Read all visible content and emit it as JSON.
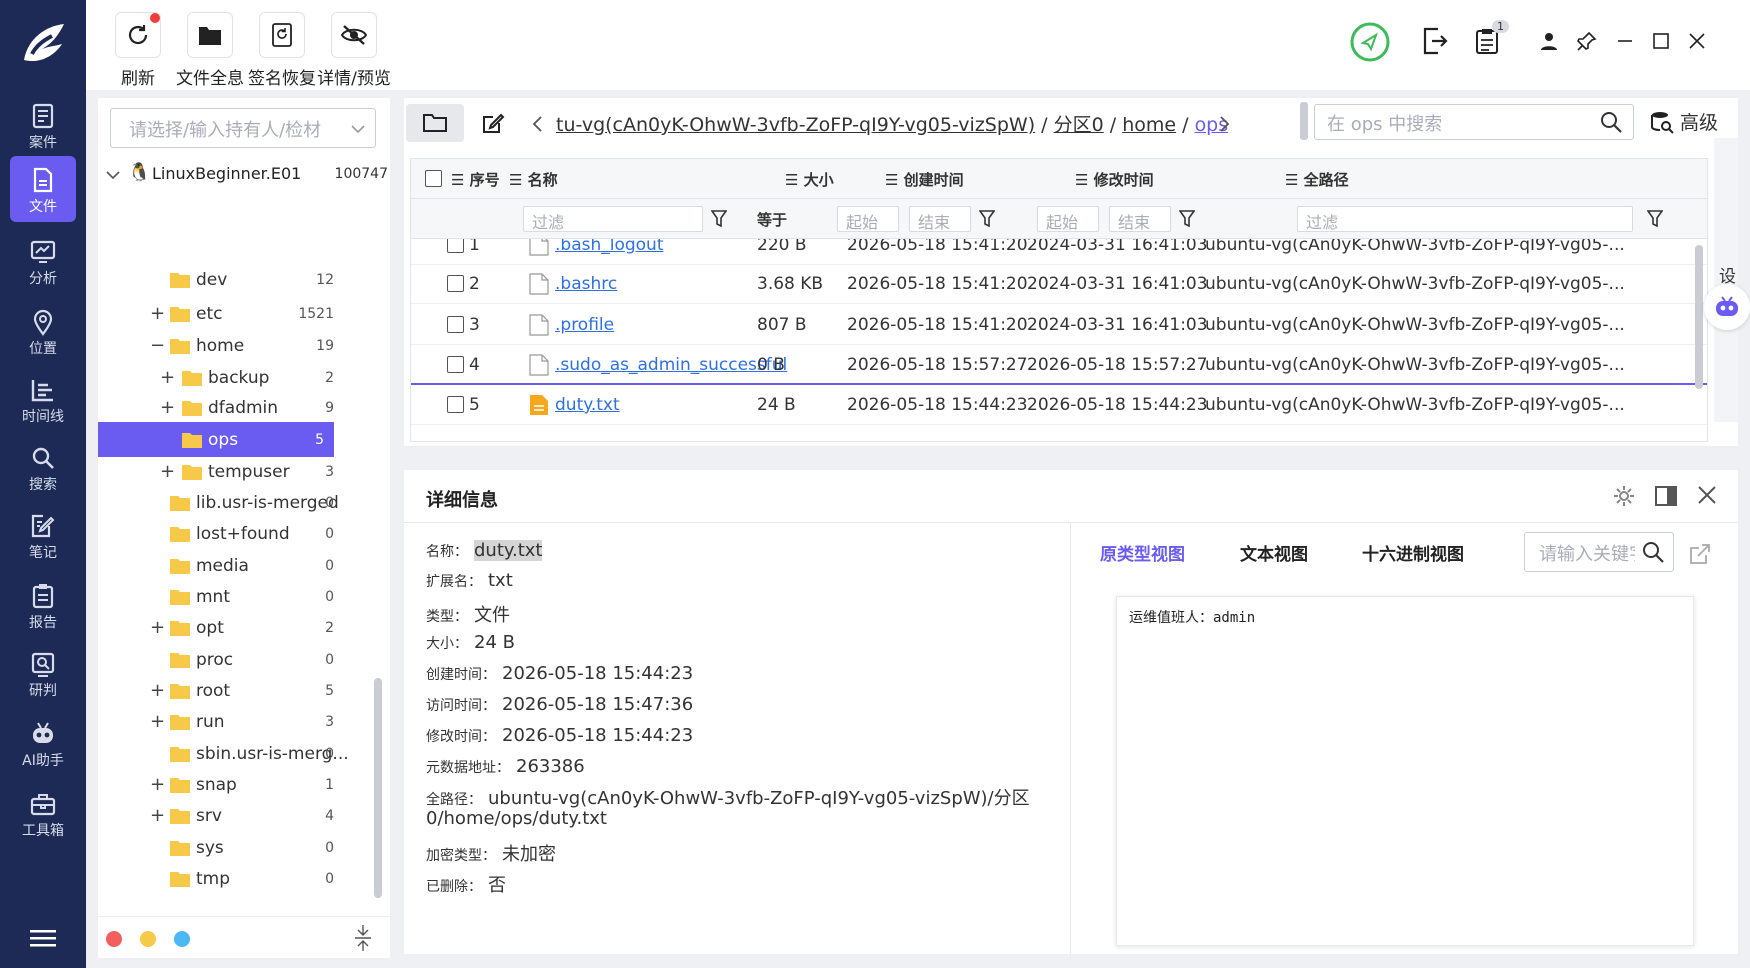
{
  "nav": {
    "items": [
      {
        "label": "案件",
        "icon": "case-icon"
      },
      {
        "label": "文件",
        "icon": "file-icon",
        "active": true
      },
      {
        "label": "分析",
        "icon": "analysis-icon"
      },
      {
        "label": "位置",
        "icon": "location-icon"
      },
      {
        "label": "时间线",
        "icon": "timeline-icon"
      },
      {
        "label": "搜索",
        "icon": "search-icon"
      },
      {
        "label": "笔记",
        "icon": "note-icon"
      },
      {
        "label": "报告",
        "icon": "report-icon"
      },
      {
        "label": "研判",
        "icon": "judge-icon"
      },
      {
        "label": "AI助手",
        "icon": "robot-icon"
      },
      {
        "label": "工具箱",
        "icon": "toolbox-icon"
      }
    ]
  },
  "toolbar": {
    "refresh": "刷新",
    "all_files": "文件全息",
    "sig_recover": "签名恢复",
    "detail_preview": "详情/预览",
    "badge_count": "1"
  },
  "tree": {
    "owner_placeholder": "请选择/输入持有人/检材",
    "root": {
      "label": "LinuxBeginner.E01",
      "count": "100747"
    },
    "rows": [
      {
        "toggle": "",
        "label": "dev",
        "count": "12"
      },
      {
        "toggle": "+",
        "label": "etc",
        "count": "1521"
      },
      {
        "toggle": "−",
        "label": "home",
        "count": "19"
      },
      {
        "toggle": "+",
        "label": "backup",
        "count": "2"
      },
      {
        "toggle": "+",
        "label": "dfadmin",
        "count": "9"
      },
      {
        "toggle": "",
        "label": "ops",
        "count": "5",
        "active": true
      },
      {
        "toggle": "+",
        "label": "tempuser",
        "count": "3"
      },
      {
        "toggle": "",
        "label": "lib.usr-is-merged",
        "count": "0"
      },
      {
        "toggle": "",
        "label": "lost+found",
        "count": "0"
      },
      {
        "toggle": "",
        "label": "media",
        "count": "0"
      },
      {
        "toggle": "",
        "label": "mnt",
        "count": "0"
      },
      {
        "toggle": "+",
        "label": "opt",
        "count": "2"
      },
      {
        "toggle": "",
        "label": "proc",
        "count": "0"
      },
      {
        "toggle": "+",
        "label": "root",
        "count": "5"
      },
      {
        "toggle": "+",
        "label": "run",
        "count": "3"
      },
      {
        "toggle": "",
        "label": "sbin.usr-is-merg...",
        "count": "0"
      },
      {
        "toggle": "+",
        "label": "snap",
        "count": "1"
      },
      {
        "toggle": "+",
        "label": "srv",
        "count": "4"
      },
      {
        "toggle": "",
        "label": "sys",
        "count": "0"
      },
      {
        "toggle": "",
        "label": "tmp",
        "count": "0"
      }
    ],
    "dots": [
      "#f25f5c",
      "#f7c948",
      "#4cb8f5"
    ]
  },
  "pathbar": {
    "crumb_partition_path": "tu-vg(cAn0yK-OhwW-3vfb-ZoFP-qI9Y-vg05-vizSpW)",
    "sep": " / ",
    "crumb_partition": "分区0",
    "crumb_home": "home",
    "crumb_ops": "ops",
    "search_placeholder": "在 ops 中搜索",
    "advanced": "高级"
  },
  "grid": {
    "headers": {
      "index": "序号",
      "name": "名称",
      "size": "大小",
      "created": "创建时间",
      "modified": "修改时间",
      "fullpath": "全路径"
    },
    "filter": {
      "placeholder": "过滤",
      "equals": "等于",
      "start": "起始",
      "end": "结束"
    },
    "rows": [
      {
        "index": "1",
        "name": ".bash_logout",
        "size": "220 B",
        "created": "2026-05-18 15:41:20",
        "modified": "2024-03-31 16:41:03",
        "path": "ubuntu-vg(cAn0yK-OhwW-3vfb-ZoFP-qI9Y-vg05-..."
      },
      {
        "index": "2",
        "name": ".bashrc",
        "size": "3.68 KB",
        "created": "2026-05-18 15:41:20",
        "modified": "2024-03-31 16:41:03",
        "path": "ubuntu-vg(cAn0yK-OhwW-3vfb-ZoFP-qI9Y-vg05-..."
      },
      {
        "index": "3",
        "name": ".profile",
        "size": "807 B",
        "created": "2026-05-18 15:41:20",
        "modified": "2024-03-31 16:41:03",
        "path": "ubuntu-vg(cAn0yK-OhwW-3vfb-ZoFP-qI9Y-vg05-..."
      },
      {
        "index": "4",
        "name": ".sudo_as_admin_successful",
        "size": "0 B",
        "created": "2026-05-18 15:57:27",
        "modified": "2026-05-18 15:57:27",
        "path": "ubuntu-vg(cAn0yK-OhwW-3vfb-ZoFP-qI9Y-vg05-..."
      },
      {
        "index": "5",
        "name": "duty.txt",
        "size": "24 B",
        "created": "2026-05-18 15:44:23",
        "modified": "2026-05-18 15:44:23",
        "path": "ubuntu-vg(cAn0yK-OhwW-3vfb-ZoFP-qI9Y-vg05-..."
      }
    ],
    "set_columns": "设置列"
  },
  "detail": {
    "title": "详细信息",
    "fields": [
      {
        "k": "名称：",
        "v": "duty.txt"
      },
      {
        "k": "扩展名：",
        "v": "txt"
      },
      {
        "k": "类型：",
        "v": "文件"
      },
      {
        "k": "大小：",
        "v": "24 B"
      },
      {
        "k": "创建时间：",
        "v": "2026-05-18 15:44:23"
      },
      {
        "k": "访问时间：",
        "v": "2026-05-18 15:47:36"
      },
      {
        "k": "修改时间：",
        "v": "2026-05-18 15:44:23"
      },
      {
        "k": "元数据地址：",
        "v": "263386"
      }
    ],
    "fullpath_label": "全路径：",
    "fullpath_line1": "ubuntu-vg(cAn0yK-OhwW-3vfb-ZoFP-qI9Y-vg05-vizSpW)/分区",
    "fullpath_line2": "0/home/ops/duty.txt",
    "enc_label": "加密类型：",
    "enc_value": "未加密",
    "del_label": "已删除：",
    "del_value": "否",
    "tabs": {
      "native": "原类型视图",
      "text": "文本视图",
      "hex": "十六进制视图"
    },
    "keyword_placeholder": "请输入关键字",
    "preview_text": "运维值班人：admin"
  },
  "colors": {
    "nav_bg": "#1c2a55",
    "accent": "#6a5cf0",
    "link": "#2f6fe0",
    "status_ok": "#3dbb5a"
  }
}
